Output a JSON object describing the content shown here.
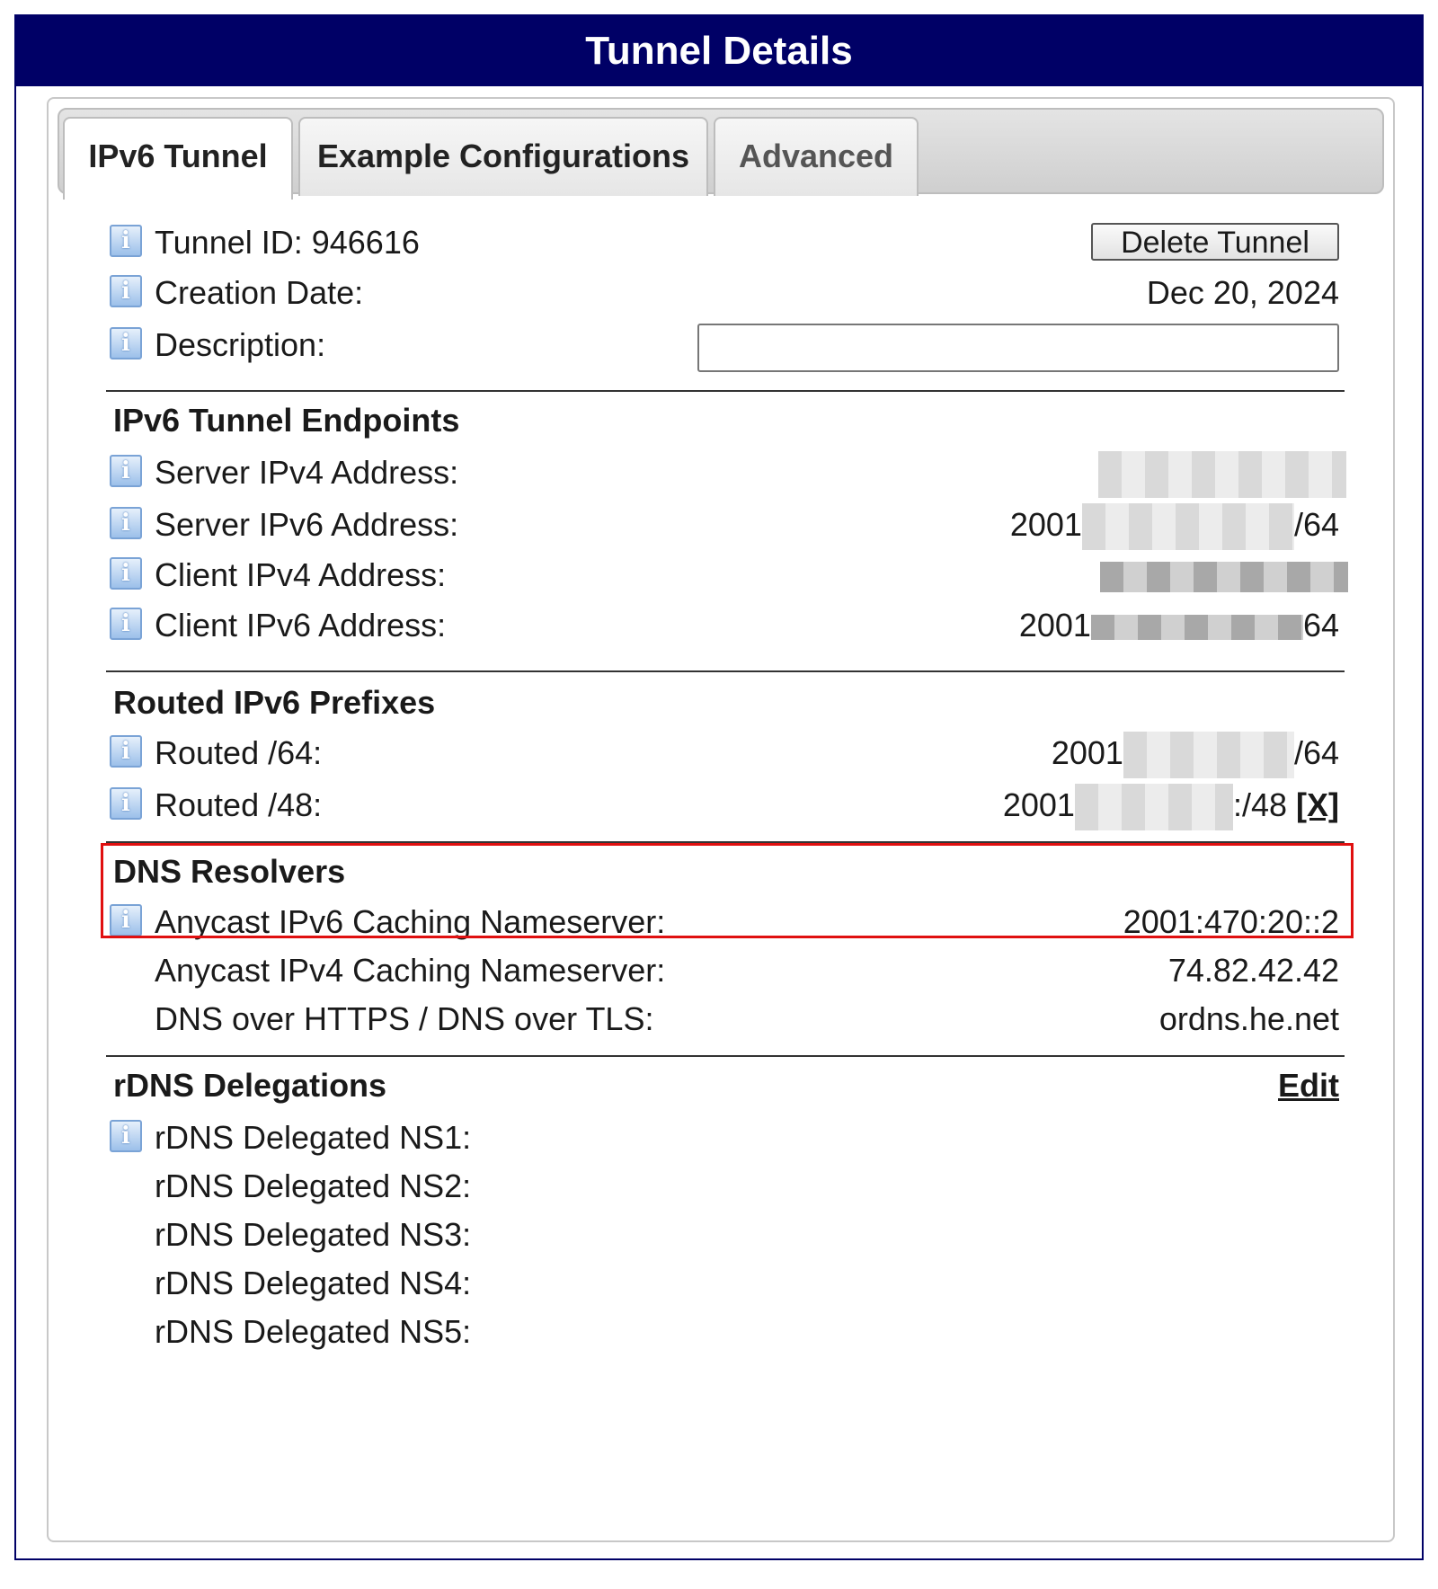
{
  "window": {
    "title": "Tunnel Details"
  },
  "tabs": [
    {
      "label": "IPv6 Tunnel",
      "active": true
    },
    {
      "label": "Example Configurations",
      "active": false
    },
    {
      "label": "Advanced",
      "active": false
    }
  ],
  "tunnel": {
    "id_label": "Tunnel ID: 946616",
    "delete_button": "Delete Tunnel",
    "creation_label": "Creation Date:",
    "creation_value": "Dec 20, 2024",
    "description_label": "Description:",
    "description_value": ""
  },
  "endpoints": {
    "title": "IPv6 Tunnel Endpoints",
    "server_ipv4_label": "Server IPv4 Address:",
    "server_ipv6_label": "Server IPv6 Address:",
    "server_ipv6_prefix": "2001",
    "server_ipv6_suffix": "/64",
    "client_ipv4_label": "Client IPv4 Address:",
    "client_ipv6_label": "Client IPv6 Address:",
    "client_ipv6_prefix": "2001",
    "client_ipv6_suffix": "64"
  },
  "routed": {
    "title": "Routed IPv6 Prefixes",
    "routed64_label": "Routed /64:",
    "routed64_prefix": "2001",
    "routed64_suffix": "/64",
    "routed48_label": "Routed /48:",
    "routed48_prefix": "2001",
    "routed48_suffix": ":/48",
    "remove_link": "[X]"
  },
  "dns": {
    "title": "DNS Resolvers",
    "anycast_v6_label": "Anycast IPv6 Caching Nameserver:",
    "anycast_v6_value": "2001:470:20::2",
    "anycast_v4_label": "Anycast IPv4 Caching Nameserver:",
    "anycast_v4_value": "74.82.42.42",
    "doh_label": "DNS over HTTPS / DNS over TLS:",
    "doh_value": "ordns.he.net"
  },
  "rdns": {
    "title": "rDNS Delegations",
    "edit_link": "Edit",
    "ns_labels": [
      "rDNS Delegated NS1:",
      "rDNS Delegated NS2:",
      "rDNS Delegated NS3:",
      "rDNS Delegated NS4:",
      "rDNS Delegated NS5:"
    ]
  },
  "icons": {
    "info": "i"
  },
  "colors": {
    "title_bar": "#000066",
    "highlight": "#e01010"
  }
}
